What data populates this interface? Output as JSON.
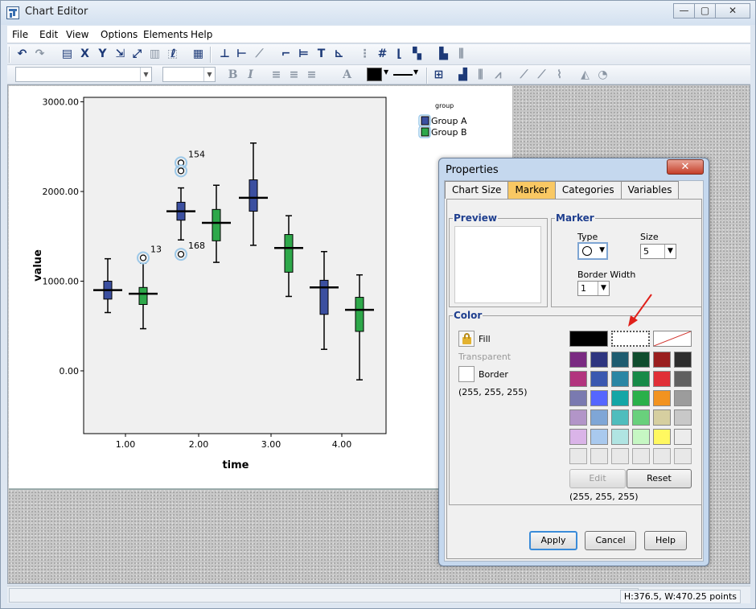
{
  "window": {
    "title": "Chart Editor",
    "btn_min": "—",
    "btn_max": "▢",
    "btn_close": "✕"
  },
  "menu": [
    "File",
    "Edit",
    "View",
    "Options",
    "Elements",
    "Help"
  ],
  "toolbar2": {
    "bold": "B",
    "italic": "I",
    "font_color_icon": "A"
  },
  "status": {
    "coords": "H:376.5, W:470.25 points"
  },
  "chart_data": {
    "type": "boxplot",
    "xlabel": "time",
    "ylabel": "value",
    "categories": [
      "1.00",
      "2.00",
      "3.00",
      "4.00"
    ],
    "yticks": [
      "0.00",
      "1000.00",
      "2000.00",
      "3000.00"
    ],
    "ylim": [
      -700,
      3050
    ],
    "legend_title": "group",
    "legend_position": "top-right",
    "series": [
      {
        "name": "Group A",
        "color": "#3b4fa0",
        "boxes": [
          {
            "min": 650,
            "q1": 800,
            "median": 900,
            "q3": 1000,
            "max": 1250
          },
          {
            "min": 1460,
            "q1": 1680,
            "median": 1780,
            "q3": 1880,
            "max": 2040
          },
          {
            "min": 1400,
            "q1": 1780,
            "median": 1930,
            "q3": 2130,
            "max": 2540
          },
          {
            "min": 240,
            "q1": 630,
            "median": 930,
            "q3": 1010,
            "max": 1330
          }
        ]
      },
      {
        "name": "Group B",
        "color": "#2ea84a",
        "boxes": [
          {
            "min": 470,
            "q1": 740,
            "median": 860,
            "q3": 930,
            "max": 1200
          },
          {
            "min": 1210,
            "q1": 1450,
            "median": 1650,
            "q3": 1800,
            "max": 2070
          },
          {
            "min": 830,
            "q1": 1100,
            "median": 1370,
            "q3": 1520,
            "max": 1730
          },
          {
            "min": -100,
            "q1": 440,
            "median": 680,
            "q3": 820,
            "max": 1070
          }
        ]
      }
    ],
    "outliers": [
      {
        "x": 1,
        "series": 1,
        "value": 1260,
        "label": "13"
      },
      {
        "x": 2,
        "series": 0,
        "value": 2320,
        "label": "154"
      },
      {
        "x": 2,
        "series": 0,
        "value": 2230,
        "label": ""
      },
      {
        "x": 2,
        "series": 0,
        "value": 1300,
        "label": "168"
      }
    ]
  },
  "dialog": {
    "title": "Properties",
    "close": "✕",
    "tabs": [
      "Chart Size",
      "Marker",
      "Categories",
      "Variables"
    ],
    "active_tab": "Marker",
    "preview_title": "Preview",
    "marker_title": "Marker",
    "type_label": "Type",
    "size_label": "Size",
    "size_value": "5",
    "border_width_label": "Border Width",
    "border_width_value": "1",
    "color_title": "Color",
    "fill_label": "Fill",
    "transparent_label": "Transparent",
    "border_label": "Border",
    "border_rgb": "(255, 255, 255)",
    "edit": "Edit",
    "reset": "Reset",
    "selected_rgb": "(255, 255, 255)",
    "apply": "Apply",
    "cancel": "Cancel",
    "help": "Help",
    "palette": [
      [
        "#7a2a82",
        "#2e3580",
        "#1e5c70",
        "#0f4d2e",
        "#9a1e1e",
        "#2d2d2d"
      ],
      [
        "#b2347e",
        "#3a58b0",
        "#2a86a4",
        "#178a48",
        "#e02f37",
        "#606060"
      ],
      [
        "#7a7ab0",
        "#5566ff",
        "#14a6a6",
        "#2ab04a",
        "#f29320",
        "#9c9c9c"
      ],
      [
        "#b295c8",
        "#7fa6d6",
        "#4fbdbd",
        "#69d07c",
        "#d6cfa0",
        "#c8c8c8"
      ],
      [
        "#dab4e8",
        "#a9c9ee",
        "#b0e4e2",
        "#c6f7c3",
        "#fff860",
        "#ececec"
      ],
      [
        "#e8e8e8",
        "#e8e8e8",
        "#e8e8e8",
        "#e8e8e8",
        "#e8e8e8",
        "#e8e8e8"
      ]
    ]
  }
}
